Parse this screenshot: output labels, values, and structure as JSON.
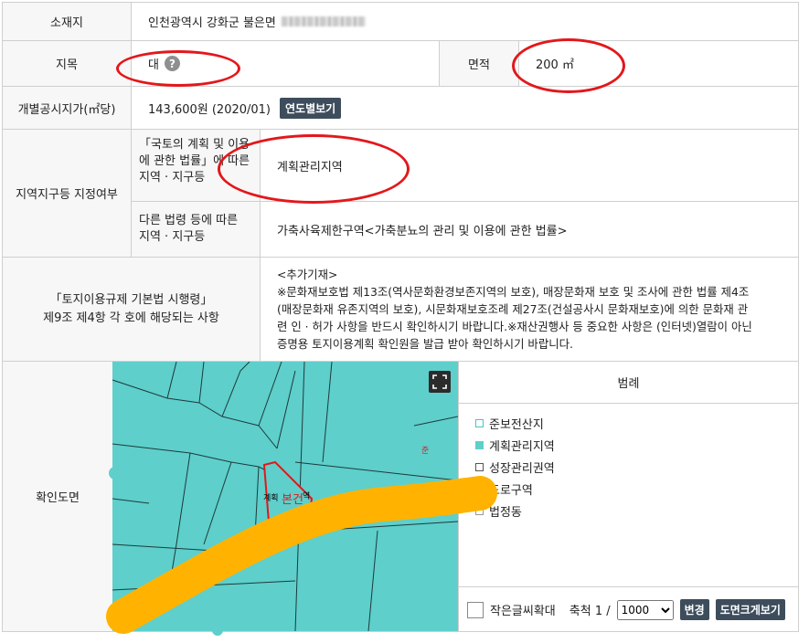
{
  "rows": {
    "location": {
      "label": "소재지",
      "value": "인천광역시 강화군 불은면"
    },
    "land_category": {
      "label": "지목",
      "value": "대",
      "help_icon": "?"
    },
    "area": {
      "label": "면적",
      "value": "200 ㎡"
    },
    "official_price": {
      "label": "개별공시지가(㎡당)",
      "value": "143,600원 (2020/01)",
      "button": "연도별보기"
    },
    "zoning": {
      "label": "지역지구등 지정여부",
      "sub1_label_line1": "「국토의 계획 및 이용",
      "sub1_label_line2": "에 관한 법률」에 따른",
      "sub1_label_line3": "지역 · 지구등",
      "sub1_value": "계획관리지역",
      "sub2_label_line1": "다른 법령 등에 따른",
      "sub2_label_line2": "지역 · 지구등",
      "sub2_value": "가축사육제한구역<가축분뇨의 관리 및 이용에 관한 법률>"
    },
    "regulation": {
      "label_line1": "「토지이용규제 기본법 시행령」",
      "label_line2": "제9조 제4항 각 호에 해당되는 사항",
      "line1": "<추가기재>",
      "line2": "※문화재보호법 제13조(역사문화환경보존지역의 보호), 매장문화재 보호 및 조사에 관한 법률 제4조",
      "line3": "(매장문화재 유존지역의 보호), 시문화재보호조례 제27조(건설공사시 문화재보호)에 의한 문화재 관",
      "line4": "련 인 · 허가 사항을 반드시 확인하시기 바랍니다.※재산권행사 등 중요한 사항은 (인터넷)열람이 아닌",
      "line5": "증명용 토지이용계획 확인원을 발급 받아 확인하시기 바랍니다."
    },
    "map": {
      "label": "확인도면",
      "parcel_label": "본건",
      "legend_title": "범례",
      "legend": [
        {
          "label": "준보전산지",
          "color": "#ffffff",
          "border": "#4cc3c0"
        },
        {
          "label": "계획관리지역",
          "color": "#5ecfcb",
          "border": "#5ecfcb"
        },
        {
          "label": "성장관리권역",
          "color": "#ffffff",
          "border": "#555555"
        },
        {
          "label": "도로구역",
          "color": "#ffffff",
          "border": "#e3171b"
        },
        {
          "label": "법정동",
          "color": "#ffffff",
          "border": "#999999"
        }
      ],
      "small_font_label": "작은글씨확대",
      "scale_label": "축척 1 /",
      "scale_value": "1000",
      "change_button": "변경",
      "large_map_button": "도면크게보기"
    }
  },
  "colors": {
    "map_fill": "#5ecfcb",
    "annotation_red": "#e3171b",
    "marker_orange": "#ffb300",
    "button_dark": "#3d4d5c"
  }
}
